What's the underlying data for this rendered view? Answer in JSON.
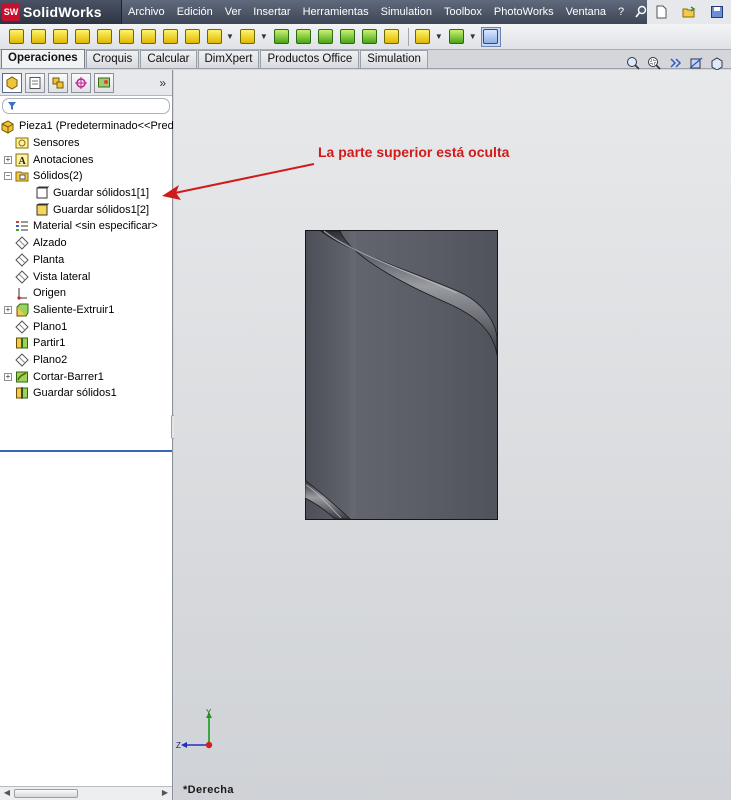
{
  "app": {
    "logo_mark": "SW",
    "name": "SolidWorks"
  },
  "menu": [
    "Archivo",
    "Edición",
    "Ver",
    "Insertar",
    "Herramientas",
    "Simulation",
    "Toolbox",
    "PhotoWorks",
    "Ventana",
    "?"
  ],
  "tabs": [
    {
      "label": "Operaciones",
      "active": true
    },
    {
      "label": "Croquis",
      "active": false
    },
    {
      "label": "Calcular",
      "active": false
    },
    {
      "label": "DimXpert",
      "active": false
    },
    {
      "label": "Productos Office",
      "active": false
    },
    {
      "label": "Simulation",
      "active": false
    }
  ],
  "feature_tree": {
    "more_symbol": "»",
    "root": "Pieza1  (Predeterminado<<Pred",
    "nodes": [
      {
        "label": "Sensores",
        "icon": "sensor-icon",
        "level": 1,
        "expander": ""
      },
      {
        "label": "Anotaciones",
        "icon": "annotations-icon",
        "level": 1,
        "expander": "+"
      },
      {
        "label": "Sólidos(2)",
        "icon": "solid-bodies-folder-icon",
        "level": 1,
        "expander": "−"
      },
      {
        "label": "Guardar sólidos1[1]",
        "icon": "hidden-body-icon",
        "level": 2,
        "expander": ""
      },
      {
        "label": "Guardar sólidos1[2]",
        "icon": "body-icon",
        "level": 2,
        "expander": ""
      },
      {
        "label": "Material <sin especificar>",
        "icon": "material-icon",
        "level": 1,
        "expander": ""
      },
      {
        "label": "Alzado",
        "icon": "plane-icon",
        "level": 1,
        "expander": ""
      },
      {
        "label": "Planta",
        "icon": "plane-icon",
        "level": 1,
        "expander": ""
      },
      {
        "label": "Vista lateral",
        "icon": "plane-icon",
        "level": 1,
        "expander": ""
      },
      {
        "label": "Origen",
        "icon": "origin-icon",
        "level": 1,
        "expander": ""
      },
      {
        "label": "Saliente-Extruir1",
        "icon": "extrude-icon",
        "level": 1,
        "expander": "+"
      },
      {
        "label": "Plano1",
        "icon": "plane-icon",
        "level": 1,
        "expander": ""
      },
      {
        "label": "Partir1",
        "icon": "split-icon",
        "level": 1,
        "expander": ""
      },
      {
        "label": "Plano2",
        "icon": "plane-icon",
        "level": 1,
        "expander": ""
      },
      {
        "label": "Cortar-Barrer1",
        "icon": "sweep-cut-icon",
        "level": 1,
        "expander": "+"
      },
      {
        "label": "Guardar sólidos1",
        "icon": "save-bodies-icon",
        "level": 1,
        "expander": ""
      }
    ]
  },
  "graphics": {
    "annotation": "La parte superior está oculta",
    "view_label": "*Derecha",
    "triad_y": "Y",
    "triad_z": "Z"
  },
  "colors": {
    "annotation": "#d11b1b",
    "part_body": "#5d6068",
    "selection_line": "#3a65b9"
  }
}
